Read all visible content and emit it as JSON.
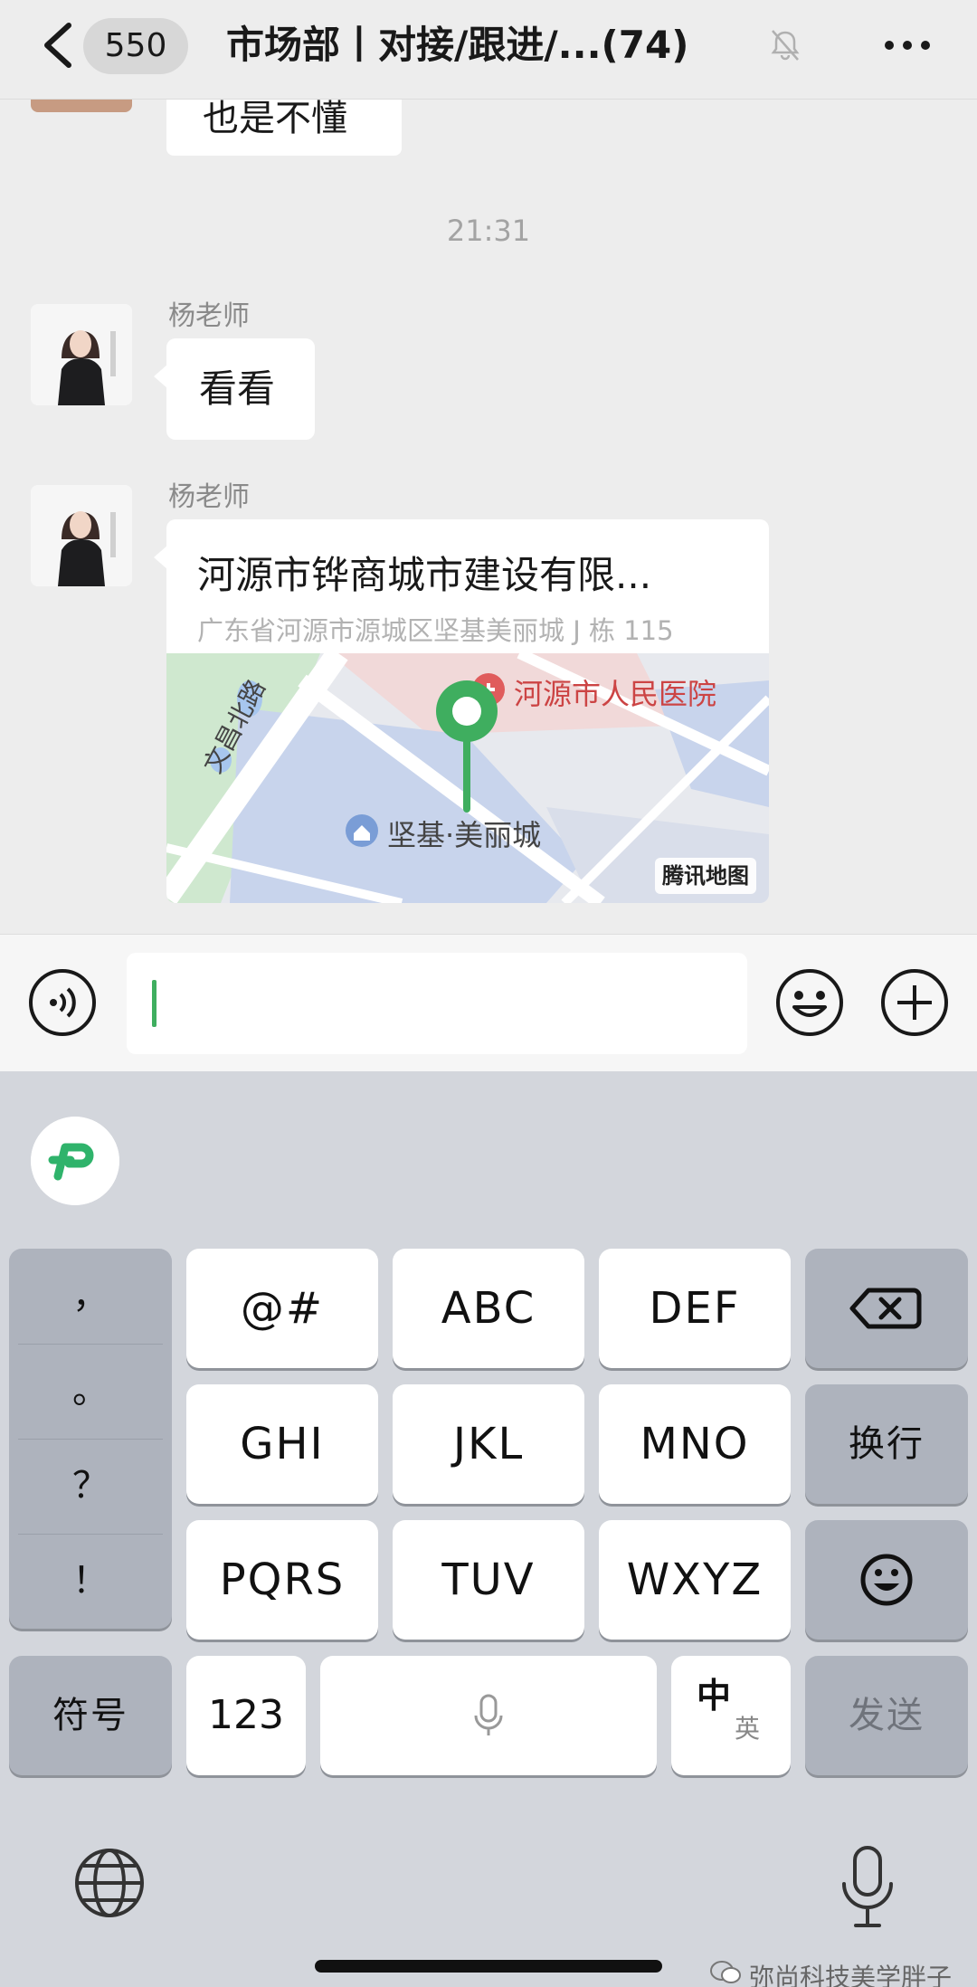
{
  "header": {
    "unread_count": "550",
    "title": "市场部丨对接/跟进/...",
    "member_count": "(74)"
  },
  "chat": {
    "previous_message": "也是不懂",
    "timestamp": "21:31",
    "messages": [
      {
        "sender": "杨老师",
        "text": "看看"
      },
      {
        "sender": "杨老师",
        "location": {
          "title": "河源市铧商城市建设有限...",
          "address": "广东省河源市源城区坚基美丽城 J 栋 115",
          "map_labels": {
            "hospital": "河源市人民医院",
            "road": "文昌北路",
            "place": "坚基·美丽城",
            "credit": "腾讯地图"
          }
        }
      }
    ]
  },
  "input": {
    "value": ""
  },
  "keyboard": {
    "punctuation": [
      "，",
      "。",
      "？",
      "！"
    ],
    "keys_row1": [
      "@#",
      "ABC",
      "DEF"
    ],
    "keys_row2": [
      "GHI",
      "JKL",
      "MNO"
    ],
    "keys_row3": [
      "PQRS",
      "TUV",
      "WXYZ"
    ],
    "newline_label": "换行",
    "symbols_label": "符号",
    "numbers_label": "123",
    "lang_zh": "中",
    "lang_en": "英",
    "send_label": "发送"
  },
  "watermark": "弥尚科技美学胖子",
  "colors": {
    "accent_green": "#3fae5f",
    "background": "#ededed"
  }
}
